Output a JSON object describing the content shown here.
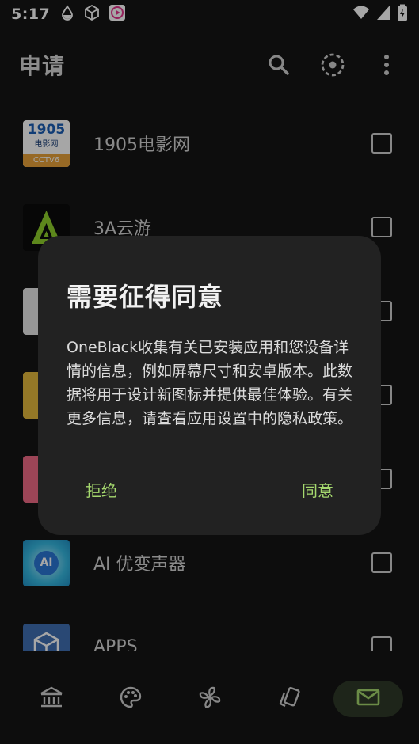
{
  "status_bar": {
    "time": "5:17"
  },
  "app_bar": {
    "title": "申请"
  },
  "apps": [
    {
      "label": "1905电影网",
      "icon_text": "1905",
      "icon_sub": "电影网",
      "icon_tag": "CCTV6"
    },
    {
      "label": "3A云游"
    },
    {
      "label": ""
    },
    {
      "label": ""
    },
    {
      "label": ""
    },
    {
      "label": "AI 优变声器",
      "icon_text": "AI"
    },
    {
      "label": "APPS"
    }
  ],
  "dialog": {
    "title": "需要征得同意",
    "body": "OneBlack收集有关已安装应用和您设备详情的信息，例如屏幕尺寸和安卓版本。此数据将用于设计新图标并提供最佳体验。有关更多信息，请查看应用设置中的隐私政策。",
    "deny": "拒绝",
    "agree": "同意"
  },
  "colors": {
    "accent": "#a5d86e",
    "background": "#141414",
    "dialog": "#222222"
  }
}
